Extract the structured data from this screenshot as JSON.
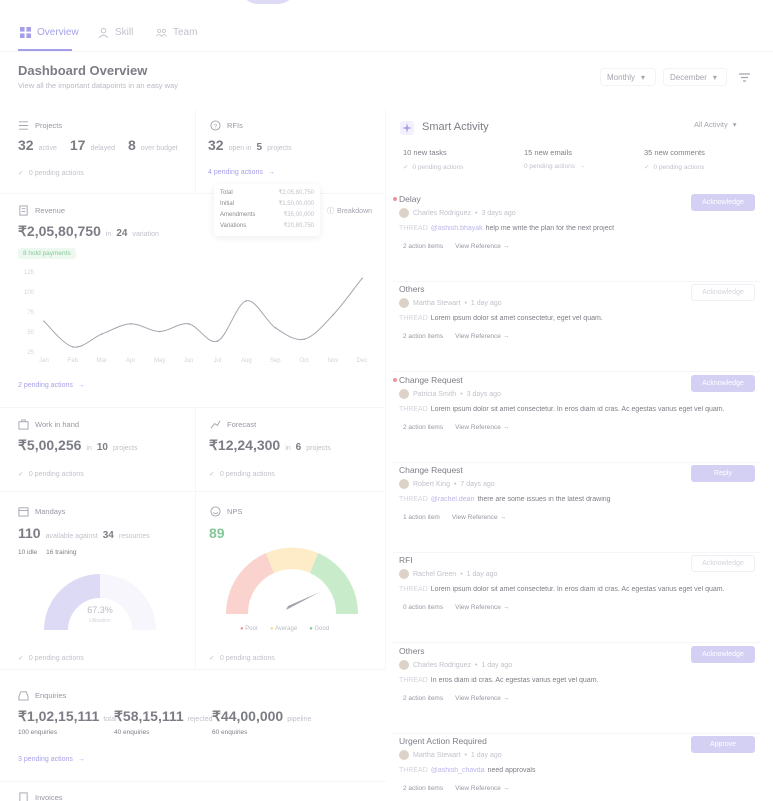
{
  "tabs": [
    {
      "label": "Overview",
      "icon": "grid-icon",
      "active": true
    },
    {
      "label": "Skill",
      "icon": "person-icon",
      "active": false
    },
    {
      "label": "Team",
      "icon": "team-icon",
      "active": false
    }
  ],
  "header": {
    "title": "Dashboard Overview",
    "subtitle": "View all the important datapoints in an easy way",
    "period_select": "Monthly",
    "month_select": "December"
  },
  "colors": {
    "accent": "#6e66d8",
    "danger": "#e0545a",
    "success": "#3aa55b"
  },
  "projects": {
    "title": "Projects",
    "active_n": "32",
    "active_l": "active",
    "delayed_n": "17",
    "delayed_l": "delayed",
    "onhold_n": "8",
    "onhold_l": "over budget",
    "pending": "0 pending actions"
  },
  "rfis": {
    "title": "RFIs",
    "open_n": "32",
    "open_l": "open in",
    "proj_n": "5",
    "proj_l": "projects",
    "link": "4 pending actions"
  },
  "revenue": {
    "title": "Revenue",
    "value": "₹2,05,80,750",
    "in": "in",
    "count": "24",
    "count_l": "variation",
    "badge": "8 hold payments",
    "breakdown": "Breakdown",
    "tooltip": [
      {
        "label": "Total",
        "value": "₹2,05,80,750"
      },
      {
        "label": "Initial",
        "value": "₹1,50,00,000"
      },
      {
        "label": "Amendments",
        "value": "₹35,00,000"
      },
      {
        "label": "Variations",
        "value": "₹20,80,750"
      }
    ],
    "link": "2 pending actions"
  },
  "chart_data": {
    "type": "line",
    "categories": [
      "Jan",
      "Feb",
      "Mar",
      "Apr",
      "May",
      "Jun",
      "Jul",
      "Aug",
      "Sep",
      "Oct",
      "Nov",
      "Dec"
    ],
    "series": [
      {
        "values": [
          48,
          8,
          28,
          44,
          32,
          44,
          17,
          80,
          38,
          20,
          58,
          115
        ]
      }
    ],
    "ticks": [
      "125",
      "100",
      "75",
      "50",
      "25"
    ],
    "ylim": [
      0,
      125
    ]
  },
  "wip": {
    "title": "Work in hand",
    "value": "₹5,00,256",
    "in": "in",
    "n": "10",
    "l": "projects",
    "pending": "0 pending actions"
  },
  "forecast": {
    "title": "Forecast",
    "value": "₹12,24,300",
    "in": "in",
    "n": "6",
    "l": "projects",
    "pending": "0 pending actions"
  },
  "mandays": {
    "title": "Mandays",
    "value": "110",
    "mid": "available against",
    "n": "34",
    "l": "resources",
    "tag1": "10 idle",
    "tag2": "16 training",
    "pct": "67.3%",
    "pct_l": "Utilisation",
    "pending": "0 pending actions"
  },
  "nps": {
    "title": "NPS",
    "value": "89",
    "legend": [
      "Poor",
      "Average",
      "Good"
    ],
    "pending": "0 pending actions"
  },
  "enquiries": {
    "title": "Enquiries",
    "items": [
      {
        "value": "₹1,02,15,111",
        "l": "total",
        "sub": "100 enquiries"
      },
      {
        "value": "₹58,15,111",
        "l": "rejected",
        "sub": "40 enquiries"
      },
      {
        "value": "₹44,00,000",
        "l": "pipeline",
        "sub": "60 enquiries"
      }
    ],
    "link": "3 pending actions"
  },
  "invoices": {
    "title": "Invoices"
  },
  "smart": {
    "title": "Smart Activity",
    "filter": "All Activity",
    "stats": [
      {
        "n": "10 new tasks",
        "p": "0 pending actions"
      },
      {
        "n": "15 new emails",
        "p": "0 pending actions"
      },
      {
        "n": "35 new comments",
        "p": "0 pending actions"
      }
    ],
    "items": [
      {
        "type": "Delay",
        "who": "Charles Rodriguez",
        "when": "3 days ago",
        "thread": "THREAD",
        "mention": "@ashish.bhayak",
        "text": "help me write the plan for the next project",
        "actions": "2 action items",
        "ref": "View Reference",
        "button": "Acknowledge",
        "btn_style": "solid",
        "dot": true
      },
      {
        "type": "Others",
        "who": "Martha Stewart",
        "when": "1 day ago",
        "thread": "THREAD",
        "mention": "",
        "text": "Lorem ipsum dolor sit amet consectetur, eget vel quam.",
        "actions": "2 action items",
        "ref": "View Reference",
        "button": "Acknowledge",
        "btn_style": "ghost",
        "dot": false
      },
      {
        "type": "Change Request",
        "who": "Patricia Smith",
        "when": "3 days ago",
        "thread": "THREAD",
        "mention": "",
        "text": "Lorem ipsum dolor sit amet consectetur. In eros diam id cras. Ac egestas varius eget vel quam.",
        "actions": "2 action items",
        "ref": "View Reference",
        "button": "Acknowledge",
        "btn_style": "solid",
        "dot": true
      },
      {
        "type": "Change Request",
        "who": "Robert King",
        "when": "7 days ago",
        "thread": "THREAD",
        "mention": "@rachel.dean",
        "text": "there are some issues in the latest drawing",
        "actions": "1 action item",
        "ref": "View Reference",
        "button": "Reply",
        "btn_style": "solid",
        "dot": false
      },
      {
        "type": "RFI",
        "who": "Rachel Green",
        "when": "1 day ago",
        "thread": "THREAD",
        "mention": "",
        "text": "Lorem ipsum dolor sit amet consectetur. In eros diam id cras. Ac egestas varius eget vel quam.",
        "actions": "0 action items",
        "ref": "View Reference",
        "button": "Acknowledge",
        "btn_style": "ghost",
        "dot": false
      },
      {
        "type": "Others",
        "who": "Charles Rodriguez",
        "when": "1 day ago",
        "thread": "THREAD",
        "mention": "",
        "text": "In eros diam id cras. Ac egestas varius eget vel quam.",
        "actions": "2 action items",
        "ref": "View Reference",
        "button": "Acknowledge",
        "btn_style": "solid",
        "dot": false
      },
      {
        "type": "Urgent Action Required",
        "who": "Martha Stewart",
        "when": "1 day ago",
        "thread": "THREAD",
        "mention": "@ashish_chavda",
        "text": "need approvals",
        "actions": "2 action items",
        "ref": "View Reference",
        "button": "Approve",
        "btn_style": "solid",
        "dot": false
      }
    ]
  }
}
